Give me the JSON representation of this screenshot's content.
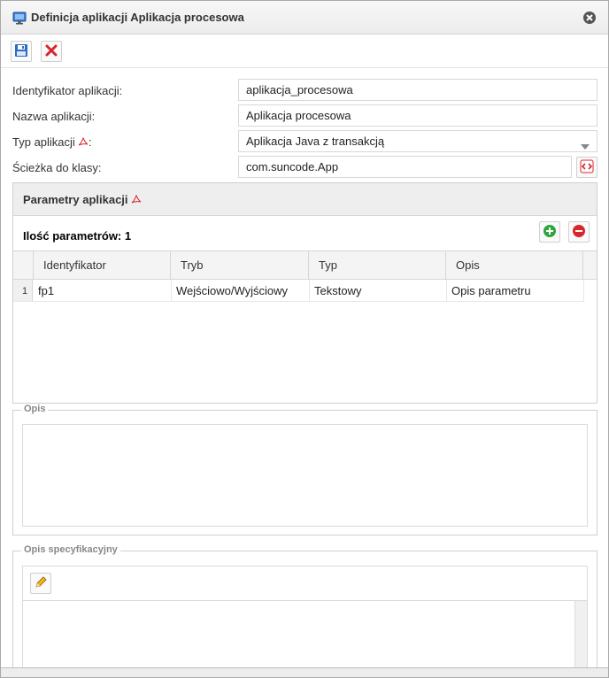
{
  "window": {
    "title": "Definicja aplikacji Aplikacja procesowa"
  },
  "icons": {
    "title": "monitor-icon",
    "close": "close-circle-icon",
    "save": "floppy-disk-icon",
    "cancel": "red-x-icon",
    "pdf": "pdf-icon",
    "add": "plus-circle-icon",
    "remove": "minus-circle-icon",
    "edit": "pencil-icon"
  },
  "form": {
    "identyfikator": {
      "label": "Identyfikator aplikacji:",
      "value": "aplikacja_procesowa"
    },
    "nazwa": {
      "label": "Nazwa aplikacji:",
      "value": "Aplikacja procesowa"
    },
    "typ": {
      "label": "Typ aplikacji",
      "suffix": ":",
      "value": "Aplikacja Java z transakcją"
    },
    "sciezka": {
      "label": "Ścieżka do klasy:",
      "value": "com.suncode.App"
    }
  },
  "parameters": {
    "title": "Parametry aplikacji",
    "count_label": "Ilość parametrów: 1",
    "columns": [
      "Identyfikator",
      "Tryb",
      "Typ",
      "Opis"
    ],
    "rows": [
      {
        "num": "1",
        "identyfikator": "fp1",
        "tryb": "Wejściowo/Wyjściowy",
        "typ": "Tekstowy",
        "opis": "Opis parametru"
      }
    ]
  },
  "opis": {
    "legend": "Opis"
  },
  "opis_spec": {
    "legend": "Opis specyfikacyjny"
  },
  "colors": {
    "accent": "#3a7dc9",
    "danger": "#d9252b",
    "add": "#2fa53b"
  }
}
